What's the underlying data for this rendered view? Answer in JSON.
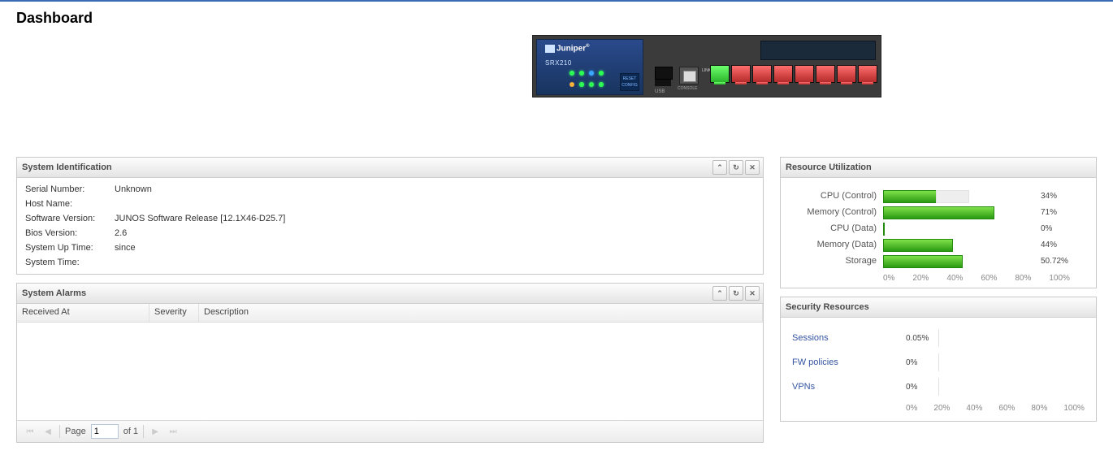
{
  "title": "Dashboard",
  "device": {
    "brand": "Juniper",
    "model": "SRX210",
    "link_label": "LINK",
    "reset": "RESET CONFIG",
    "usb": "USB",
    "console": "CONSOLE",
    "ports": [
      {
        "status": "up"
      },
      {
        "status": "down"
      },
      {
        "status": "down"
      },
      {
        "status": "down"
      },
      {
        "status": "down"
      },
      {
        "status": "down"
      },
      {
        "status": "down"
      },
      {
        "status": "down"
      }
    ]
  },
  "sysid": {
    "title": "System Identification",
    "rows": [
      {
        "k": "Serial Number:",
        "v": "Unknown"
      },
      {
        "k": "Host Name:",
        "v": ""
      },
      {
        "k": "Software Version:",
        "v": "JUNOS Software Release [12.1X46-D25.7]"
      },
      {
        "k": "Bios Version:",
        "v": "2.6"
      },
      {
        "k": "System Up Time:",
        "v": "since"
      },
      {
        "k": "System Time:",
        "v": ""
      }
    ]
  },
  "alarms": {
    "title": "System Alarms",
    "cols": {
      "received": "Received At",
      "severity": "Severity",
      "description": "Description"
    },
    "pager": {
      "page_label": "Page",
      "page": "1",
      "of_label": "of 1"
    }
  },
  "resutil": {
    "title": "Resource Utilization",
    "rows": [
      {
        "label": "CPU (Control)",
        "value": 34,
        "text": "34%",
        "ghost": 55
      },
      {
        "label": "Memory (Control)",
        "value": 71,
        "text": "71%",
        "ghost": 0
      },
      {
        "label": "CPU (Data)",
        "value": 0,
        "text": "0%",
        "ghost": 0
      },
      {
        "label": "Memory (Data)",
        "value": 44,
        "text": "44%",
        "ghost": 0
      },
      {
        "label": "Storage",
        "value": 50.72,
        "text": "50.72%",
        "ghost": 0
      }
    ],
    "axis": [
      "0%",
      "20%",
      "40%",
      "60%",
      "80%",
      "100%"
    ]
  },
  "secres": {
    "title": "Security Resources",
    "rows": [
      {
        "label": "Sessions",
        "text": "0.05%"
      },
      {
        "label": "FW policies",
        "text": "0%"
      },
      {
        "label": "VPNs",
        "text": "0%"
      }
    ],
    "axis": [
      "0%",
      "20%",
      "40%",
      "60%",
      "80%",
      "100%"
    ]
  },
  "tools": {
    "collapse": "⌃",
    "refresh": "↻",
    "close": "✕"
  },
  "chart_data": [
    {
      "type": "bar",
      "orientation": "horizontal",
      "title": "Resource Utilization",
      "xlabel": "",
      "ylabel": "",
      "xlim": [
        0,
        100
      ],
      "categories": [
        "CPU (Control)",
        "Memory (Control)",
        "CPU (Data)",
        "Memory (Data)",
        "Storage"
      ],
      "values": [
        34,
        71,
        0,
        44,
        50.72
      ],
      "unit": "%"
    },
    {
      "type": "bar",
      "orientation": "horizontal",
      "title": "Security Resources",
      "xlabel": "",
      "ylabel": "",
      "xlim": [
        0,
        100
      ],
      "categories": [
        "Sessions",
        "FW policies",
        "VPNs"
      ],
      "values": [
        0.05,
        0,
        0
      ],
      "unit": "%"
    }
  ]
}
